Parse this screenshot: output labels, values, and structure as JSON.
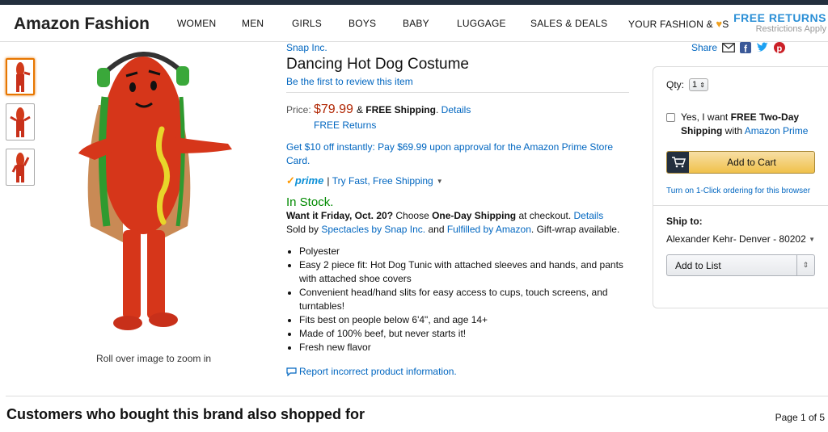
{
  "nav": {
    "brand": "Amazon Fashion",
    "links": [
      "WOMEN",
      "MEN",
      "GIRLS",
      "BOYS",
      "BABY",
      "LUGGAGE",
      "SALES & DEALS"
    ],
    "your_fashion": "YOUR FASHION &",
    "your_fashion_suffix": "S",
    "promo_title": "FREE RETURNS",
    "promo_sub": "Restrictions Apply"
  },
  "gallery": {
    "zoom_hint": "Roll over image to zoom in"
  },
  "product": {
    "brand_link": "Snap Inc.",
    "title": "Dancing Hot Dog Costume",
    "review_link": "Be the first to review this item",
    "price_label": "Price:",
    "price": "$79.99",
    "shipping_prefix": "&",
    "shipping_bold": "FREE Shipping",
    "shipping_suffix": ".",
    "details_link": "Details",
    "free_returns": "FREE Returns",
    "promo": "Get $10 off instantly: Pay $69.99 upon approval for the Amazon Prime Store Card.",
    "prime_logo": "prime",
    "prime_sep": "|",
    "prime_text": "Try Fast, Free Shipping",
    "stock": "In Stock.",
    "delivery_bold": "Want it Friday, Oct. 20?",
    "delivery_mid": "Choose",
    "delivery_option": "One-Day Shipping",
    "delivery_end": "at checkout.",
    "delivery_details": "Details",
    "sold_by_prefix": "Sold by",
    "sold_by_link": "Spectacles by Snap Inc.",
    "sold_by_and": "and",
    "fulfilled_link": "Fulfilled by Amazon",
    "gift_wrap": ". Gift-wrap available.",
    "bullets": [
      "Polyester",
      "Easy 2 piece fit: Hot Dog Tunic with attached sleeves and hands, and pants with attached shoe covers",
      "Convenient head/hand slits for easy access to cups, touch screens, and turntables!",
      "Fits best on people below 6'4\", and age 14+",
      "Made of 100% beef, but never starts it!",
      "Fresh new flavor"
    ],
    "report_link": "Report incorrect product information."
  },
  "share": {
    "label": "Share"
  },
  "buybox": {
    "qty_label": "Qty:",
    "qty_value": "1",
    "two_day_prefix": "Yes, I want",
    "two_day_bold": "FREE Two-Day Shipping",
    "two_day_with": "with",
    "two_day_link": "Amazon Prime",
    "add_to_cart": "Add to Cart",
    "one_click": "Turn on 1-Click ordering for this browser",
    "ship_to_label": "Ship to:",
    "ship_to_value": "Alexander Kehr- Denver - 80202",
    "add_to_list": "Add to List"
  },
  "footer": {
    "section_title": "Customers who bought this brand also shopped for",
    "page_count": "Page 1 of 5"
  },
  "colors": {
    "price": "#b12704",
    "link": "#0066c0",
    "in_stock": "#008a00",
    "cart_button": "#f0c14b",
    "promo_blue": "#2a8fd6"
  }
}
